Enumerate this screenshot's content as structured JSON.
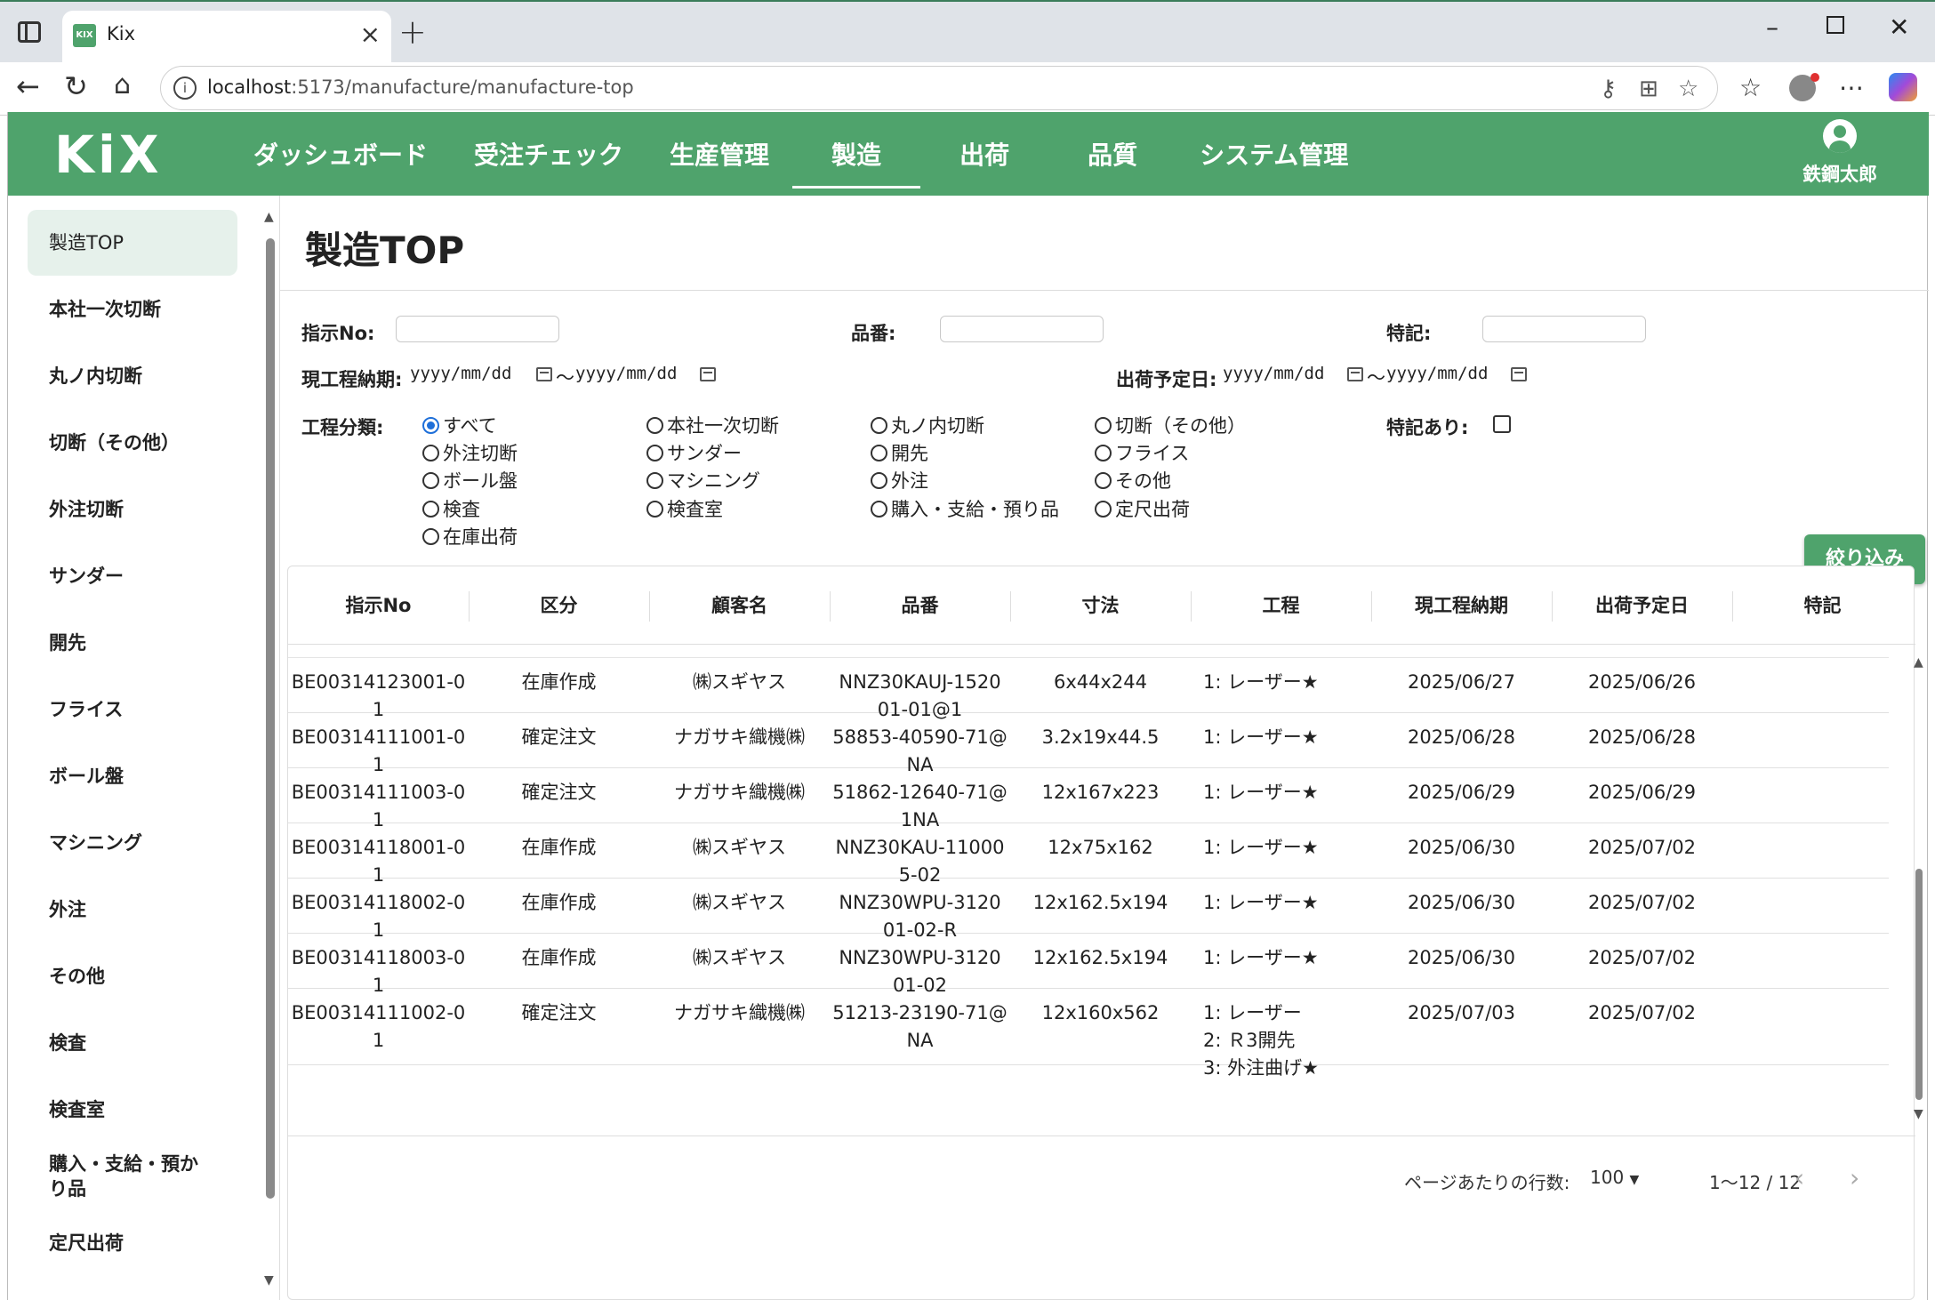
{
  "browser": {
    "tab_title": "Kix",
    "favicon_text": "KIX",
    "url_host": "localhost",
    "url_rest": ":5173/manufacture/manufacture-top"
  },
  "app": {
    "logo": "KiX",
    "nav": [
      "ダッシュボード",
      "受注チェック",
      "生産管理",
      "製造",
      "出荷",
      "品質",
      "システム管理"
    ],
    "active_nav": "製造",
    "user_name": "鉄鋼太郎",
    "accent_color": "#4fa36c"
  },
  "sidebar": {
    "items": [
      "製造TOP",
      "本社一次切断",
      "丸ノ内切断",
      "切断（その他）",
      "外注切断",
      "サンダー",
      "開先",
      "フライス",
      "ボール盤",
      "マシニング",
      "外注",
      "その他",
      "検査",
      "検査室",
      "購入・支給・預かり品",
      "定尺出荷"
    ],
    "active": "製造TOP"
  },
  "page": {
    "title": "製造TOP"
  },
  "filter": {
    "order_no_label": "指示No:",
    "part_no_label": "品番:",
    "note_label": "特記:",
    "due_label": "現工程納期:",
    "ship_label": "出荷予定日:",
    "date_placeholder": "yyyy/mm/dd",
    "tilde": "〜",
    "process_label": "工程分類:",
    "note_check_label": "特記あり:",
    "process_options": [
      [
        "すべて",
        "外注切断",
        "ボール盤",
        "検査",
        "在庫出荷"
      ],
      [
        "本社一次切断",
        "サンダー",
        "マシニング",
        "検査室"
      ],
      [
        "丸ノ内切断",
        "開先",
        "外注",
        "購入・支給・預り品"
      ],
      [
        "切断（その他）",
        "フライス",
        "その他",
        "定尺出荷"
      ]
    ],
    "selected_process": "すべて",
    "submit": "絞り込み"
  },
  "table": {
    "headers": [
      "指示No",
      "区分",
      "顧客名",
      "品番",
      "寸法",
      "工程",
      "現工程納期",
      "出荷予定日",
      "特記"
    ],
    "rows": [
      [
        "BE00314123001-0\n1",
        "在庫作成",
        "㈱スギヤス",
        "NNZ30KAUJ-1520\n01-01@1",
        "6x44x244",
        "1: レーザー★",
        "2025/06/27",
        "2025/06/26",
        ""
      ],
      [
        "BE00314111001-0\n1",
        "確定注文",
        "ナガサキ織機㈱",
        "58853-40590-71@\nNA",
        "3.2x19x44.5",
        "1: レーザー★",
        "2025/06/28",
        "2025/06/28",
        ""
      ],
      [
        "BE00314111003-0\n1",
        "確定注文",
        "ナガサキ織機㈱",
        "51862-12640-71@\n1NA",
        "12x167x223",
        "1: レーザー★",
        "2025/06/29",
        "2025/06/29",
        ""
      ],
      [
        "BE00314118001-0\n1",
        "在庫作成",
        "㈱スギヤス",
        "NNZ30KAU-11000\n5-02",
        "12x75x162",
        "1: レーザー★",
        "2025/06/30",
        "2025/07/02",
        ""
      ],
      [
        "BE00314118002-0\n1",
        "在庫作成",
        "㈱スギヤス",
        "NNZ30WPU-3120\n01-02-R",
        "12x162.5x194",
        "1: レーザー★",
        "2025/06/30",
        "2025/07/02",
        ""
      ],
      [
        "BE00314118003-0\n1",
        "在庫作成",
        "㈱スギヤス",
        "NNZ30WPU-3120\n01-02",
        "12x162.5x194",
        "1: レーザー★",
        "2025/06/30",
        "2025/07/02",
        ""
      ],
      [
        "BE00314111002-0\n1",
        "確定注文",
        "ナガサキ織機㈱",
        "51213-23190-71@\nNA",
        "12x160x562",
        "1: レーザー\n2: Ｒ3開先\n3: 外注曲げ★",
        "2025/07/03",
        "2025/07/02",
        ""
      ]
    ],
    "rows_per_page_label": "ページあたりの行数:",
    "rows_per_page": "100",
    "range": "1〜12 / 12"
  }
}
